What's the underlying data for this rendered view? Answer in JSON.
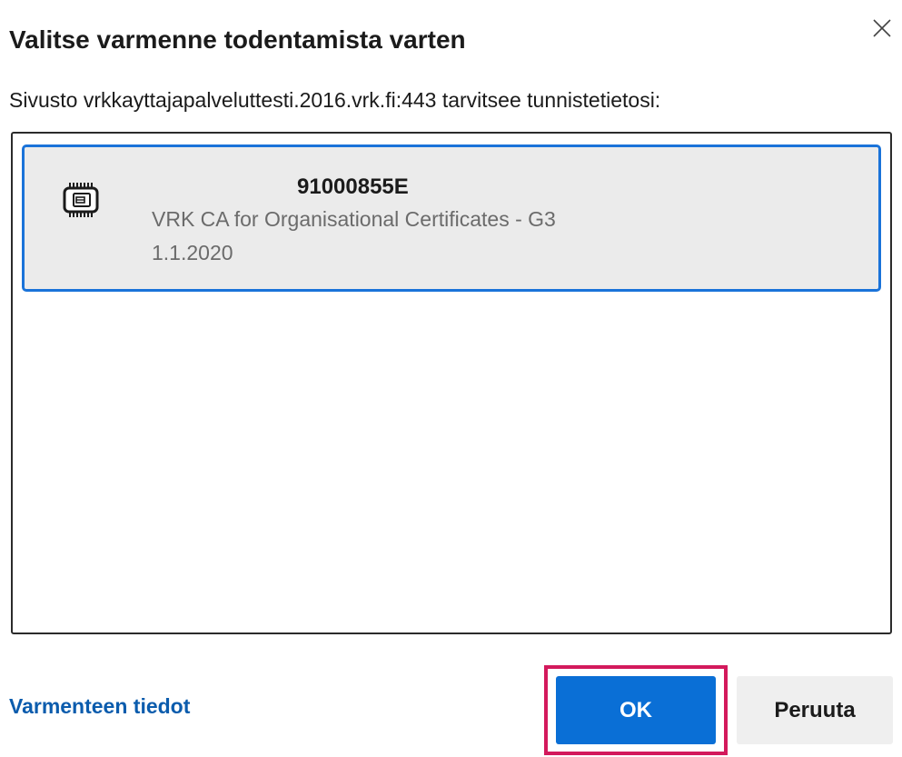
{
  "dialog": {
    "title": "Valitse varmenne todentamista varten",
    "subtitle": "Sivusto vrkkayttajapalveluttesti.2016.vrk.fi:443 tarvitsee tunnistetietosi:",
    "close_icon": "close-icon"
  },
  "certificates": [
    {
      "icon": "smartcard-chip-icon",
      "name": "91000855E",
      "issuer": "VRK CA for Organisational Certificates - G3",
      "date": "1.1.2020",
      "selected": true
    }
  ],
  "footer": {
    "details_link": "Varmenteen tiedot",
    "ok_label": "OK",
    "cancel_label": "Peruuta"
  },
  "colors": {
    "accent": "#0a6fd6",
    "selection_border": "#1a73d9",
    "highlight_frame": "#d3195c",
    "link": "#0b5cad"
  }
}
